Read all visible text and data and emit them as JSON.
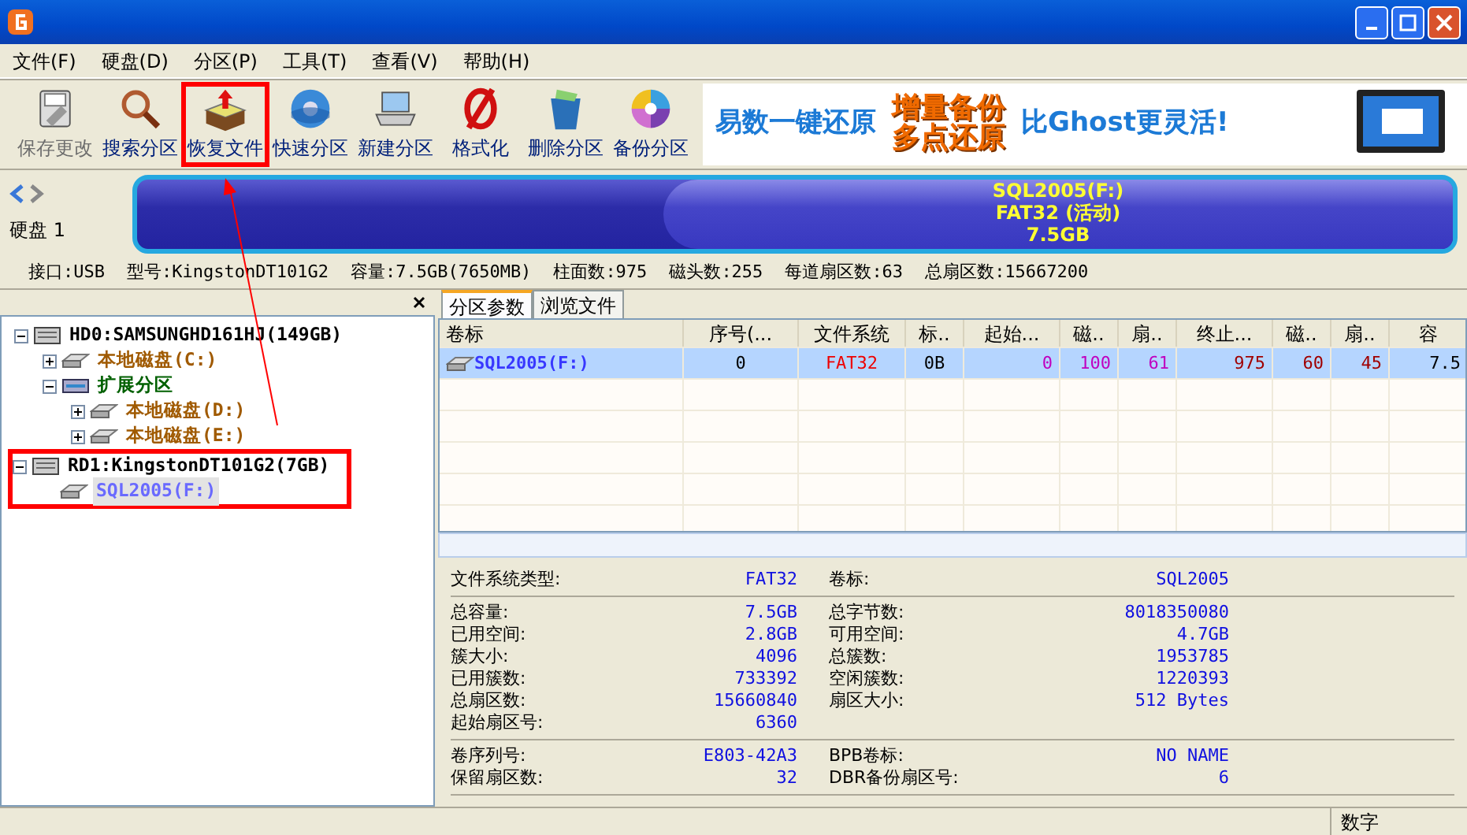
{
  "menu": [
    "文件(F)",
    "硬盘(D)",
    "分区(P)",
    "工具(T)",
    "查看(V)",
    "帮助(H)"
  ],
  "toolbar": [
    {
      "label": "保存更改",
      "kind": "save",
      "disabled": true,
      "highlighted": false
    },
    {
      "label": "搜索分区",
      "kind": "search",
      "disabled": false,
      "highlighted": false
    },
    {
      "label": "恢复文件",
      "kind": "recover",
      "disabled": false,
      "highlighted": true
    },
    {
      "label": "快速分区",
      "kind": "quick",
      "disabled": false,
      "highlighted": false
    },
    {
      "label": "新建分区",
      "kind": "new",
      "disabled": false,
      "highlighted": false
    },
    {
      "label": "格式化",
      "kind": "format",
      "disabled": false,
      "highlighted": false
    },
    {
      "label": "删除分区",
      "kind": "delete",
      "disabled": false,
      "highlighted": false
    },
    {
      "label": "备份分区",
      "kind": "backup",
      "disabled": false,
      "highlighted": false
    }
  ],
  "banner": {
    "slogan": "易数一键还原",
    "promo": [
      "增量备份",
      "多点还原"
    ],
    "tagline": "比Ghost更灵活!"
  },
  "disk_panel": {
    "label": "硬盘 1",
    "partition": [
      "SQL2005(F:)",
      "FAT32 (活动)",
      "7.5GB"
    ],
    "info": [
      "接口:USB",
      "型号:KingstonDT101G2",
      "容量:7.5GB(7650MB)",
      "柱面数:975",
      "磁头数:255",
      "每道扇区数:63",
      "总扇区数:15667200"
    ]
  },
  "tree": [
    {
      "label": "HD0:SAMSUNGHD161HJ(149GB)",
      "kind": "disk",
      "expanded": true,
      "selected": false,
      "highlighted": false,
      "children": [
        {
          "label": "本地磁盘(C:)",
          "kind": "partition",
          "expanded": false,
          "selected": false,
          "highlighted": false
        },
        {
          "label": "扩展分区",
          "kind": "extended",
          "expanded": true,
          "selected": false,
          "highlighted": false,
          "children": [
            {
              "label": "本地磁盘(D:)",
              "kind": "partition",
              "expanded": false,
              "selected": false,
              "highlighted": false
            },
            {
              "label": "本地磁盘(E:)",
              "kind": "partition",
              "expanded": false,
              "selected": false,
              "highlighted": false
            }
          ]
        }
      ]
    },
    {
      "label": "RD1:KingstonDT101G2(7GB)",
      "kind": "disk",
      "expanded": true,
      "selected": false,
      "highlighted": true,
      "children": [
        {
          "label": "SQL2005(F:)",
          "kind": "partition",
          "selected": true,
          "highlighted": false
        }
      ]
    }
  ],
  "tabs": [
    {
      "label": "分区参数",
      "selected": true
    },
    {
      "label": "浏览文件",
      "selected": false
    }
  ],
  "table": {
    "columns": [
      "卷标",
      "序号(...",
      "文件系统",
      "标..",
      "起始...",
      "磁..",
      "扇..",
      "终止...",
      "磁..",
      "扇..",
      "容"
    ],
    "rows": [
      {
        "selected": true,
        "cells": [
          "SQL2005(F:)",
          "0",
          "FAT32",
          "0B",
          "0",
          "100",
          "61",
          "975",
          "60",
          "45",
          "7.5"
        ]
      }
    ]
  },
  "details": [
    [
      [
        "文件系统类型:",
        "FAT32",
        "卷标:",
        "SQL2005"
      ]
    ],
    [
      [
        "总容量:",
        "7.5GB",
        "总字节数:",
        "8018350080"
      ],
      [
        "已用空间:",
        "2.8GB",
        "可用空间:",
        "4.7GB"
      ],
      [
        "簇大小:",
        "4096",
        "总簇数:",
        "1953785"
      ],
      [
        "已用簇数:",
        "733392",
        "空闲簇数:",
        "1220393"
      ],
      [
        "总扇区数:",
        "15660840",
        "扇区大小:",
        "512 Bytes"
      ],
      [
        "起始扇区号:",
        "6360"
      ]
    ],
    [
      [
        "卷序列号:",
        "E803-42A3",
        "BPB卷标:",
        "NO NAME"
      ],
      [
        "保留扇区数:",
        "32",
        "DBR备份扇区号:",
        "6"
      ]
    ]
  ],
  "status_bar": [
    "数字"
  ]
}
